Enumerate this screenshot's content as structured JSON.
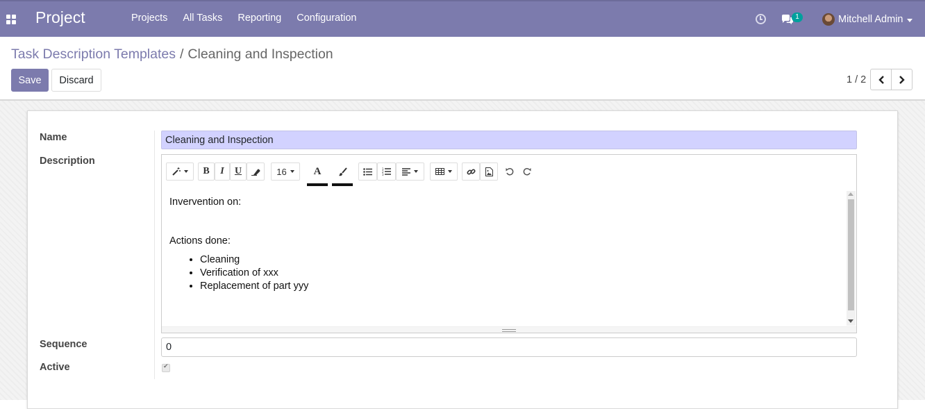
{
  "navbar": {
    "app_name": "Project",
    "menu": [
      "Projects",
      "All Tasks",
      "Reporting",
      "Configuration"
    ],
    "chat_count": "1",
    "user_name": "Mitchell Admin"
  },
  "breadcrumb": {
    "parent": "Task Description Templates",
    "separator": "/",
    "current": "Cleaning and Inspection"
  },
  "buttons": {
    "save": "Save",
    "discard": "Discard"
  },
  "pager": {
    "value": "1 / 2"
  },
  "form": {
    "name_label": "Name",
    "name_value": "Cleaning and Inspection",
    "description_label": "Description",
    "sequence_label": "Sequence",
    "sequence_value": "0",
    "active_label": "Active",
    "active_checked": true
  },
  "editor": {
    "font_size": "16",
    "bold": "B",
    "italic": "I",
    "underline": "U",
    "font_color_glyph": "A",
    "content": {
      "line1": "Invervention on:",
      "line2": "Actions done:",
      "items": [
        "Cleaning",
        "Verification of xxx",
        "Replacement of part yyy"
      ]
    }
  },
  "colors": {
    "brand": "#7c7bad",
    "name_field_bg": "#d2d2ff",
    "badge": "#00a09d"
  }
}
